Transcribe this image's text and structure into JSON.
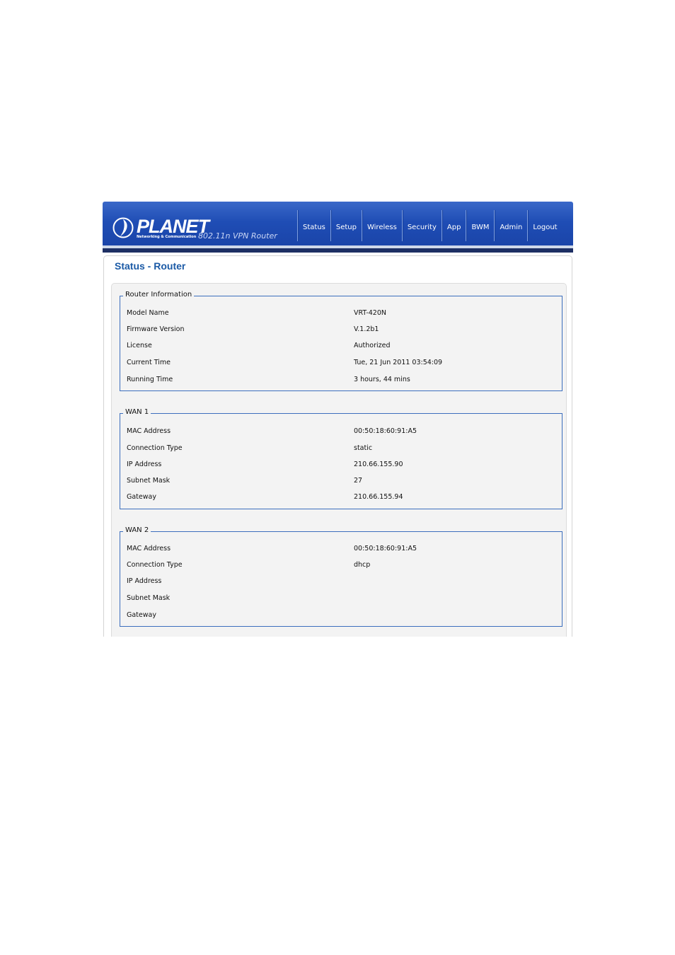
{
  "header": {
    "brand": "PLANET",
    "tagline": "Networking & Communication",
    "product": "802.11n VPN Router"
  },
  "nav": [
    {
      "label": "Status"
    },
    {
      "label": "Setup"
    },
    {
      "label": "Wireless"
    },
    {
      "label": "Security"
    },
    {
      "label": "App"
    },
    {
      "label": "BWM"
    },
    {
      "label": "Admin"
    },
    {
      "label": "Logout"
    }
  ],
  "page": {
    "title": "Status - Router"
  },
  "router_info": {
    "legend": "Router Information",
    "rows": [
      {
        "label": "Model Name",
        "value": "VRT-420N"
      },
      {
        "label": "Firmware Version",
        "value": "V.1.2b1"
      },
      {
        "label": "License",
        "value": "Authorized"
      },
      {
        "label": "Current Time",
        "value": "Tue, 21 Jun 2011 03:54:09"
      },
      {
        "label": "Running Time",
        "value": "3 hours, 44 mins"
      }
    ]
  },
  "wan1": {
    "legend": "WAN 1",
    "rows": [
      {
        "label": "MAC Address",
        "value": "00:50:18:60:91:A5"
      },
      {
        "label": "Connection Type",
        "value": "static"
      },
      {
        "label": "IP Address",
        "value": "210.66.155.90"
      },
      {
        "label": "Subnet Mask",
        "value": "27"
      },
      {
        "label": "Gateway",
        "value": "210.66.155.94"
      }
    ]
  },
  "wan2": {
    "legend": "WAN 2",
    "rows": [
      {
        "label": "MAC Address",
        "value": "00:50:18:60:91:A5"
      },
      {
        "label": "Connection Type",
        "value": "dhcp"
      },
      {
        "label": "IP Address",
        "value": ""
      },
      {
        "label": "Subnet Mask",
        "value": ""
      },
      {
        "label": "Gateway",
        "value": ""
      }
    ]
  }
}
